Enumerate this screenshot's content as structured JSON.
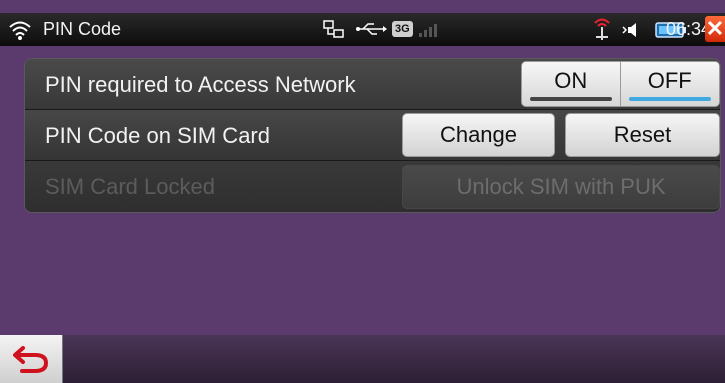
{
  "status_bar": {
    "title": "PIN Code",
    "network_badge": "3G",
    "time": "06:34",
    "close_symbol": "✕",
    "icons": [
      "wifi-icon",
      "network-icon",
      "usb-icon",
      "signal-icon",
      "no-service-icon",
      "speaker-icon",
      "battery-icon",
      "close-icon"
    ]
  },
  "settings": {
    "pin_required": {
      "label": "PIN required to Access Network",
      "on_label": "ON",
      "off_label": "OFF",
      "selected": "OFF"
    },
    "pin_code": {
      "label": "PIN Code on SIM Card",
      "change_label": "Change",
      "reset_label": "Reset"
    },
    "sim_locked": {
      "label": "SIM Card Locked",
      "unlock_label": "Unlock SIM with PUK",
      "enabled": false
    }
  },
  "bottom_bar": {
    "back_icon": "back-arrow-icon"
  },
  "colors": {
    "background": "#5b3a6e",
    "toggle_selected_indicator": "#3fa9e0",
    "close_button": "#e0401a"
  }
}
